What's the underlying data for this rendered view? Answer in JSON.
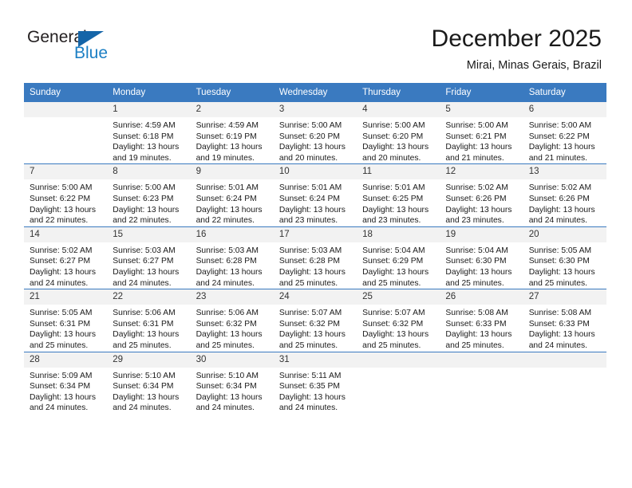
{
  "brand": {
    "name_part1": "General",
    "name_part2": "Blue",
    "triangle_icon": "triangle-icon",
    "color_dark": "#231f20",
    "color_blue": "#1c7fc4"
  },
  "header": {
    "month_title": "December 2025",
    "location": "Mirai, Minas Gerais, Brazil"
  },
  "theme": {
    "header_blue": "#3a7ac0",
    "daynum_bg": "#f2f2f2",
    "text": "#1a1a1a"
  },
  "calendar": {
    "weekday_headers": [
      "Sunday",
      "Monday",
      "Tuesday",
      "Wednesday",
      "Thursday",
      "Friday",
      "Saturday"
    ],
    "weeks": [
      [
        {
          "day": "",
          "sunrise": "",
          "sunset": "",
          "daylight_1": "",
          "daylight_2": ""
        },
        {
          "day": "1",
          "sunrise": "Sunrise: 4:59 AM",
          "sunset": "Sunset: 6:18 PM",
          "daylight_1": "Daylight: 13 hours",
          "daylight_2": "and 19 minutes."
        },
        {
          "day": "2",
          "sunrise": "Sunrise: 4:59 AM",
          "sunset": "Sunset: 6:19 PM",
          "daylight_1": "Daylight: 13 hours",
          "daylight_2": "and 19 minutes."
        },
        {
          "day": "3",
          "sunrise": "Sunrise: 5:00 AM",
          "sunset": "Sunset: 6:20 PM",
          "daylight_1": "Daylight: 13 hours",
          "daylight_2": "and 20 minutes."
        },
        {
          "day": "4",
          "sunrise": "Sunrise: 5:00 AM",
          "sunset": "Sunset: 6:20 PM",
          "daylight_1": "Daylight: 13 hours",
          "daylight_2": "and 20 minutes."
        },
        {
          "day": "5",
          "sunrise": "Sunrise: 5:00 AM",
          "sunset": "Sunset: 6:21 PM",
          "daylight_1": "Daylight: 13 hours",
          "daylight_2": "and 21 minutes."
        },
        {
          "day": "6",
          "sunrise": "Sunrise: 5:00 AM",
          "sunset": "Sunset: 6:22 PM",
          "daylight_1": "Daylight: 13 hours",
          "daylight_2": "and 21 minutes."
        }
      ],
      [
        {
          "day": "7",
          "sunrise": "Sunrise: 5:00 AM",
          "sunset": "Sunset: 6:22 PM",
          "daylight_1": "Daylight: 13 hours",
          "daylight_2": "and 22 minutes."
        },
        {
          "day": "8",
          "sunrise": "Sunrise: 5:00 AM",
          "sunset": "Sunset: 6:23 PM",
          "daylight_1": "Daylight: 13 hours",
          "daylight_2": "and 22 minutes."
        },
        {
          "day": "9",
          "sunrise": "Sunrise: 5:01 AM",
          "sunset": "Sunset: 6:24 PM",
          "daylight_1": "Daylight: 13 hours",
          "daylight_2": "and 22 minutes."
        },
        {
          "day": "10",
          "sunrise": "Sunrise: 5:01 AM",
          "sunset": "Sunset: 6:24 PM",
          "daylight_1": "Daylight: 13 hours",
          "daylight_2": "and 23 minutes."
        },
        {
          "day": "11",
          "sunrise": "Sunrise: 5:01 AM",
          "sunset": "Sunset: 6:25 PM",
          "daylight_1": "Daylight: 13 hours",
          "daylight_2": "and 23 minutes."
        },
        {
          "day": "12",
          "sunrise": "Sunrise: 5:02 AM",
          "sunset": "Sunset: 6:26 PM",
          "daylight_1": "Daylight: 13 hours",
          "daylight_2": "and 23 minutes."
        },
        {
          "day": "13",
          "sunrise": "Sunrise: 5:02 AM",
          "sunset": "Sunset: 6:26 PM",
          "daylight_1": "Daylight: 13 hours",
          "daylight_2": "and 24 minutes."
        }
      ],
      [
        {
          "day": "14",
          "sunrise": "Sunrise: 5:02 AM",
          "sunset": "Sunset: 6:27 PM",
          "daylight_1": "Daylight: 13 hours",
          "daylight_2": "and 24 minutes."
        },
        {
          "day": "15",
          "sunrise": "Sunrise: 5:03 AM",
          "sunset": "Sunset: 6:27 PM",
          "daylight_1": "Daylight: 13 hours",
          "daylight_2": "and 24 minutes."
        },
        {
          "day": "16",
          "sunrise": "Sunrise: 5:03 AM",
          "sunset": "Sunset: 6:28 PM",
          "daylight_1": "Daylight: 13 hours",
          "daylight_2": "and 24 minutes."
        },
        {
          "day": "17",
          "sunrise": "Sunrise: 5:03 AM",
          "sunset": "Sunset: 6:28 PM",
          "daylight_1": "Daylight: 13 hours",
          "daylight_2": "and 25 minutes."
        },
        {
          "day": "18",
          "sunrise": "Sunrise: 5:04 AM",
          "sunset": "Sunset: 6:29 PM",
          "daylight_1": "Daylight: 13 hours",
          "daylight_2": "and 25 minutes."
        },
        {
          "day": "19",
          "sunrise": "Sunrise: 5:04 AM",
          "sunset": "Sunset: 6:30 PM",
          "daylight_1": "Daylight: 13 hours",
          "daylight_2": "and 25 minutes."
        },
        {
          "day": "20",
          "sunrise": "Sunrise: 5:05 AM",
          "sunset": "Sunset: 6:30 PM",
          "daylight_1": "Daylight: 13 hours",
          "daylight_2": "and 25 minutes."
        }
      ],
      [
        {
          "day": "21",
          "sunrise": "Sunrise: 5:05 AM",
          "sunset": "Sunset: 6:31 PM",
          "daylight_1": "Daylight: 13 hours",
          "daylight_2": "and 25 minutes."
        },
        {
          "day": "22",
          "sunrise": "Sunrise: 5:06 AM",
          "sunset": "Sunset: 6:31 PM",
          "daylight_1": "Daylight: 13 hours",
          "daylight_2": "and 25 minutes."
        },
        {
          "day": "23",
          "sunrise": "Sunrise: 5:06 AM",
          "sunset": "Sunset: 6:32 PM",
          "daylight_1": "Daylight: 13 hours",
          "daylight_2": "and 25 minutes."
        },
        {
          "day": "24",
          "sunrise": "Sunrise: 5:07 AM",
          "sunset": "Sunset: 6:32 PM",
          "daylight_1": "Daylight: 13 hours",
          "daylight_2": "and 25 minutes."
        },
        {
          "day": "25",
          "sunrise": "Sunrise: 5:07 AM",
          "sunset": "Sunset: 6:32 PM",
          "daylight_1": "Daylight: 13 hours",
          "daylight_2": "and 25 minutes."
        },
        {
          "day": "26",
          "sunrise": "Sunrise: 5:08 AM",
          "sunset": "Sunset: 6:33 PM",
          "daylight_1": "Daylight: 13 hours",
          "daylight_2": "and 25 minutes."
        },
        {
          "day": "27",
          "sunrise": "Sunrise: 5:08 AM",
          "sunset": "Sunset: 6:33 PM",
          "daylight_1": "Daylight: 13 hours",
          "daylight_2": "and 24 minutes."
        }
      ],
      [
        {
          "day": "28",
          "sunrise": "Sunrise: 5:09 AM",
          "sunset": "Sunset: 6:34 PM",
          "daylight_1": "Daylight: 13 hours",
          "daylight_2": "and 24 minutes."
        },
        {
          "day": "29",
          "sunrise": "Sunrise: 5:10 AM",
          "sunset": "Sunset: 6:34 PM",
          "daylight_1": "Daylight: 13 hours",
          "daylight_2": "and 24 minutes."
        },
        {
          "day": "30",
          "sunrise": "Sunrise: 5:10 AM",
          "sunset": "Sunset: 6:34 PM",
          "daylight_1": "Daylight: 13 hours",
          "daylight_2": "and 24 minutes."
        },
        {
          "day": "31",
          "sunrise": "Sunrise: 5:11 AM",
          "sunset": "Sunset: 6:35 PM",
          "daylight_1": "Daylight: 13 hours",
          "daylight_2": "and 24 minutes."
        },
        {
          "day": "",
          "sunrise": "",
          "sunset": "",
          "daylight_1": "",
          "daylight_2": ""
        },
        {
          "day": "",
          "sunrise": "",
          "sunset": "",
          "daylight_1": "",
          "daylight_2": ""
        },
        {
          "day": "",
          "sunrise": "",
          "sunset": "",
          "daylight_1": "",
          "daylight_2": ""
        }
      ]
    ]
  }
}
